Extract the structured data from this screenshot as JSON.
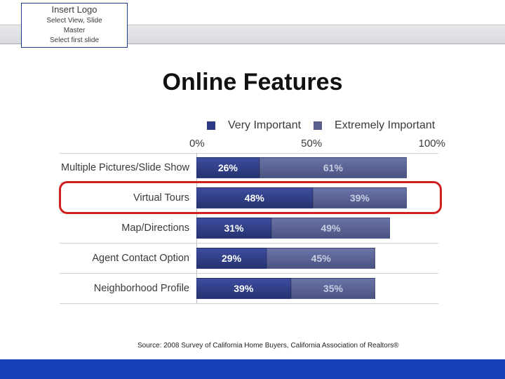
{
  "logo": {
    "title": "Insert Logo",
    "line1": "Select View, Slide",
    "line2": "Master",
    "line3": "Select first slide"
  },
  "title": "Online Features",
  "source": "Source: 2008 Survey of California Home Buyers, California Association of Realtors®",
  "chart_data": {
    "type": "bar",
    "title": "Online Features",
    "categories": [
      "Multiple Pictures/Slide Show",
      "Virtual Tours",
      "Map/Directions",
      "Agent Contact Option",
      "Neighborhood Profile"
    ],
    "series": [
      {
        "name": "Very Important",
        "values": [
          26,
          48,
          31,
          29,
          39
        ]
      },
      {
        "name": "Extremely Important",
        "values": [
          61,
          39,
          49,
          45,
          35
        ]
      }
    ],
    "xlabel": "",
    "ylabel": "",
    "xlim": [
      0,
      100
    ],
    "ticks": [
      "0%",
      "50%",
      "100%"
    ],
    "highlight_row": 1,
    "legend_position": "top"
  }
}
